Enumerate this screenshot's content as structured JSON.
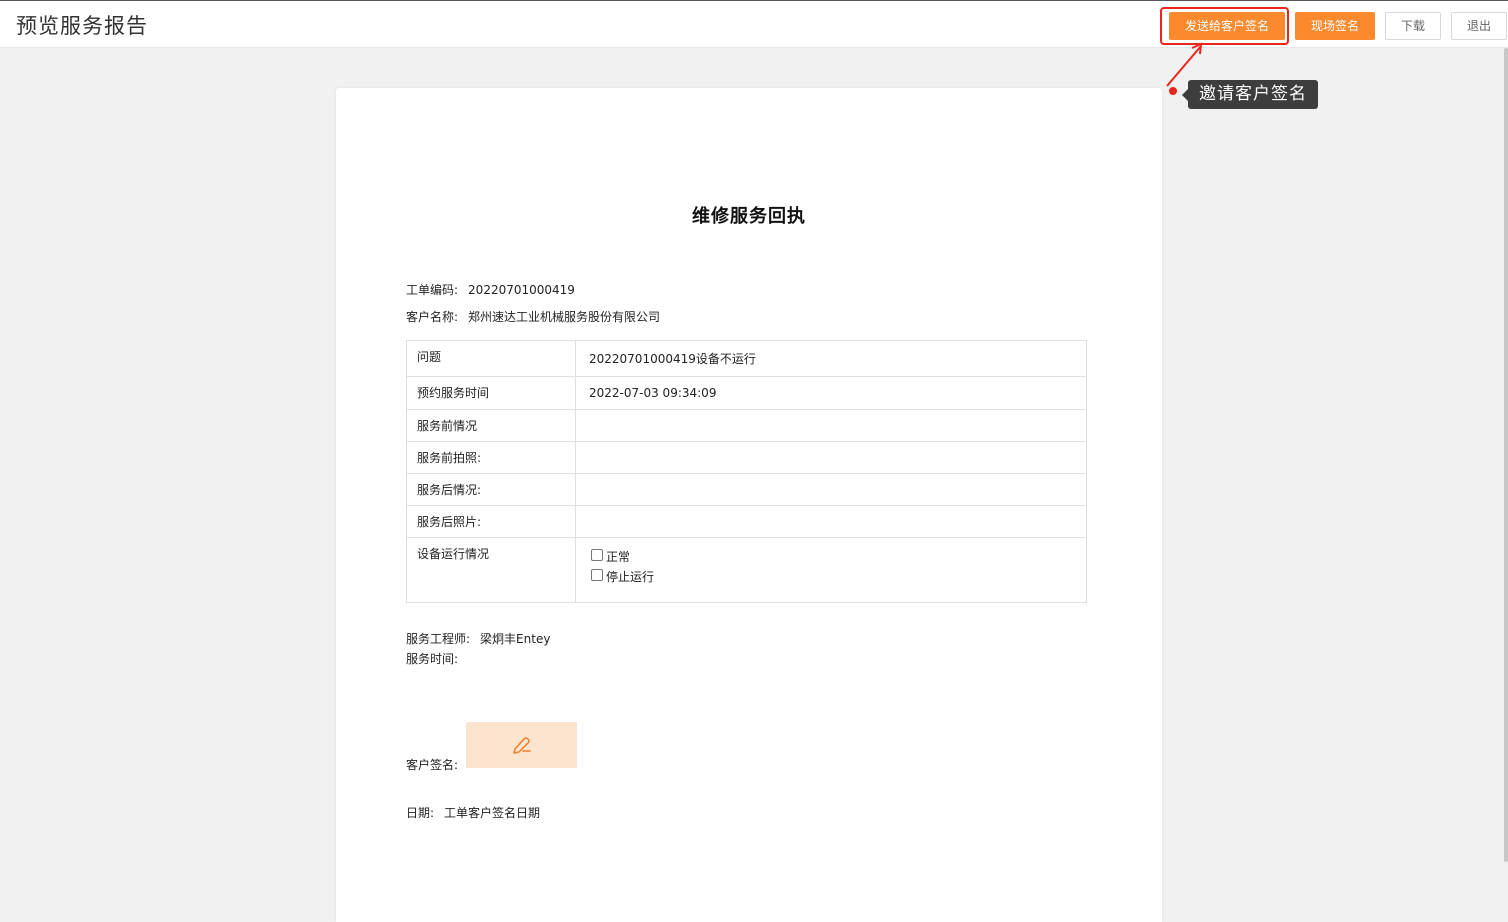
{
  "header": {
    "title": "预览服务报告",
    "buttons": {
      "send": "发送给客户签名",
      "onsite": "现场签名",
      "download": "下载",
      "exit": "退出"
    }
  },
  "annotation": {
    "tooltip": "邀请客户签名",
    "color": "#e8261c"
  },
  "document": {
    "title": "维修服务回执",
    "order": {
      "label": "工单编码:",
      "value": "20220701000419"
    },
    "customer": {
      "label": "客户名称:",
      "value": "郑州速达工业机械服务股份有限公司"
    },
    "rows": [
      {
        "label": "问题",
        "value": "20220701000419设备不运行"
      },
      {
        "label": "预约服务时间",
        "value": "2022-07-03 09:34:09"
      },
      {
        "label": "服务前情况",
        "value": ""
      },
      {
        "label": "服务前拍照:",
        "value": ""
      },
      {
        "label": "服务后情况:",
        "value": ""
      },
      {
        "label": "服务后照片:",
        "value": ""
      },
      {
        "label": "设备运行情况",
        "options": [
          "正常",
          "停止运行"
        ]
      }
    ],
    "engineer": {
      "label": "服务工程师:",
      "value": "梁炯丰Entey"
    },
    "service_time": {
      "label": "服务时间:"
    },
    "signature": {
      "label": "客户签名:",
      "icon": "pen-icon"
    },
    "date": {
      "label": "日期:",
      "value": "工单客户签名日期"
    }
  },
  "colors": {
    "accent": "#fb8a2e",
    "signature_bg": "#fde4cf",
    "tooltip_bg": "#3d3d3d"
  }
}
